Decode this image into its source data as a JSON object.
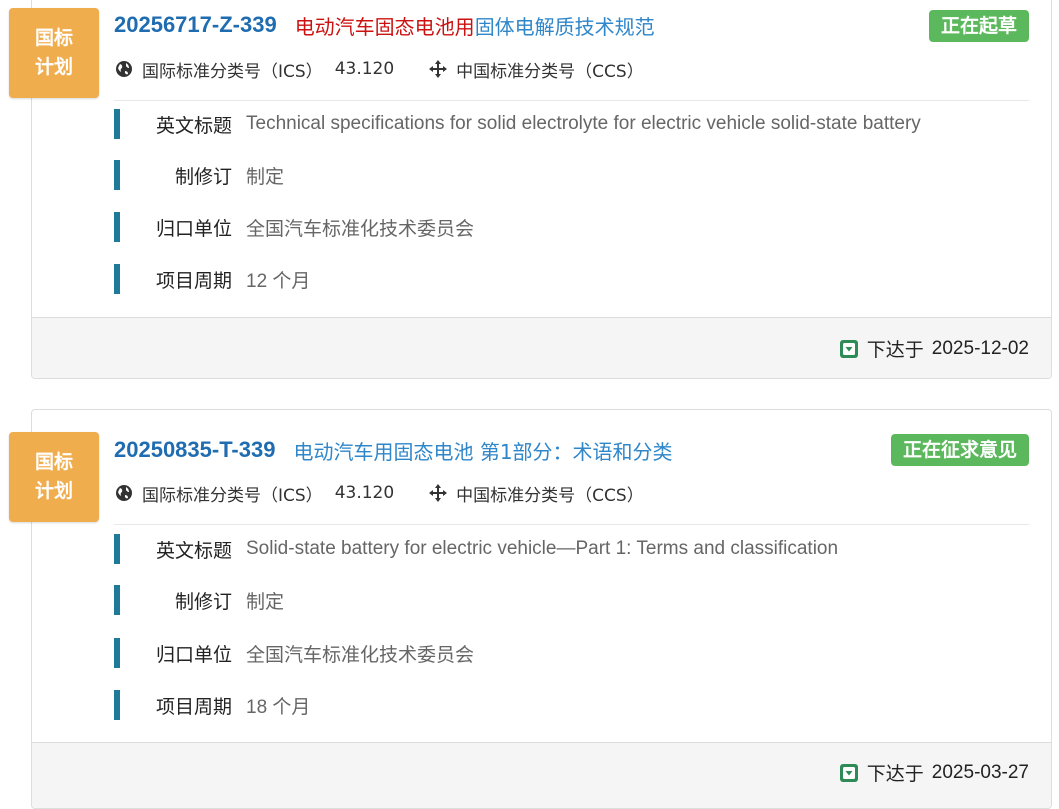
{
  "items": [
    {
      "badge": [
        "国标",
        "计划"
      ],
      "code": "20256717-Z-339",
      "title_highlight": "电动汽车固态电池用",
      "title_rest": "固体电解质技术规范",
      "status": "正在起草",
      "ics_label": "国际标准分类号（ICS）",
      "ics_value": "43.120",
      "ccs_label": "中国标准分类号（CCS）",
      "fields": [
        {
          "label": "英文标题",
          "value": "Technical specifications for solid electrolyte for electric vehicle solid-state battery"
        },
        {
          "label": "制修订",
          "value": "制定"
        },
        {
          "label": "归口单位",
          "value": "全国汽车标准化技术委员会"
        },
        {
          "label": "项目周期",
          "value": "12 个月"
        }
      ],
      "issued_label": "下达于",
      "issued_date": "2025-12-02"
    },
    {
      "badge": [
        "国标",
        "计划"
      ],
      "code": "20250835-T-339",
      "title_highlight": "",
      "title_rest": "电动汽车用固态电池 第1部分：术语和分类",
      "status": "正在征求意见",
      "ics_label": "国际标准分类号（ICS）",
      "ics_value": "43.120",
      "ccs_label": "中国标准分类号（CCS）",
      "fields": [
        {
          "label": "英文标题",
          "value": "Solid-state battery for electric vehicle—Part 1: Terms and classification"
        },
        {
          "label": "制修订",
          "value": "制定"
        },
        {
          "label": "归口单位",
          "value": "全国汽车标准化技术委员会"
        },
        {
          "label": "项目周期",
          "value": "18 个月"
        }
      ],
      "issued_label": "下达于",
      "issued_date": "2025-03-27"
    }
  ],
  "colors": {
    "badge": "#f0ad4e",
    "code": "#1f6cb0",
    "title_highlight": "#cc1111",
    "title_link": "#2f86c9",
    "status": "#5cb85c",
    "field_bar": "#1f7a9a"
  },
  "icons": {
    "ics": "globe-icon",
    "ccs": "crosshair-arrows-icon",
    "issued": "calendar-down-icon"
  }
}
